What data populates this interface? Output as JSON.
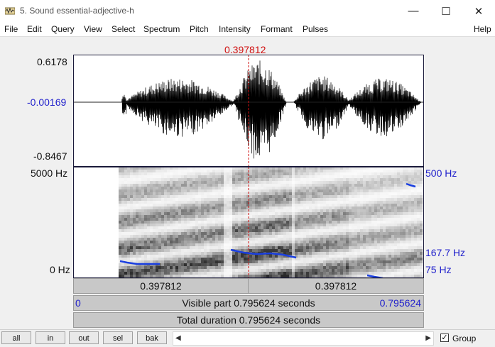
{
  "window": {
    "title": "5. Sound essential-adjective-h",
    "minimize_glyph": "—",
    "maximize_glyph": "☐",
    "close_glyph": "✕"
  },
  "menu": {
    "file": "File",
    "edit": "Edit",
    "query": "Query",
    "view": "View",
    "select": "Select",
    "spectrum": "Spectrum",
    "pitch": "Pitch",
    "intensity": "Intensity",
    "formant": "Formant",
    "pulses": "Pulses",
    "help": "Help"
  },
  "cursor_time": "0.397812",
  "waveform": {
    "max_label": "0.6178",
    "zero_label": "-0.00169",
    "min_label": "-0.8467"
  },
  "spectrogram": {
    "freq_top": "5000 Hz",
    "freq_bottom": "0 Hz",
    "pitch_top": "500 Hz",
    "pitch_value": "167.7 Hz",
    "pitch_bottom": "75 Hz"
  },
  "time_bar": {
    "left": "0.397812",
    "right": "0.397812"
  },
  "visible_bar": {
    "start": "0",
    "text": "Visible part 0.795624 seconds",
    "end": "0.795624"
  },
  "total_bar": {
    "text": "Total duration 0.795624 seconds"
  },
  "buttons": {
    "all": "all",
    "in": "in",
    "out": "out",
    "sel": "sel",
    "bak": "bak"
  },
  "group": {
    "label": "Group",
    "checked": true
  },
  "colors": {
    "pitch": "#1a3fe0",
    "cursor": "#d01010",
    "axis_blue": "#2222cc"
  }
}
